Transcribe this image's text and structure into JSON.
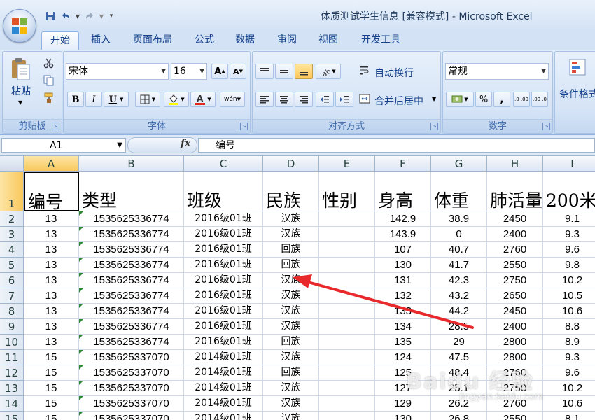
{
  "window": {
    "title": "体质测试学生信息  [兼容模式] - Microsoft Excel"
  },
  "ribbon": {
    "tabs": [
      "开始",
      "插入",
      "页面布局",
      "公式",
      "数据",
      "审阅",
      "视图",
      "开发工具"
    ],
    "active_tab": "开始",
    "clipboard": {
      "paste_label": "粘贴",
      "group_label": "剪贴板"
    },
    "font": {
      "name": "宋体",
      "size": "16",
      "group_label": "字体",
      "bold": "B",
      "italic": "I",
      "underline": "U",
      "grow": "A",
      "shrink": "A",
      "phonetic": "wén"
    },
    "alignment": {
      "wrap_label": "自动换行",
      "merge_label": "合并后居中",
      "group_label": "对齐方式"
    },
    "number": {
      "format": "常规",
      "group_label": "数字",
      "percent": "%",
      "comma": ",",
      "inc_decimal": ".0 .00",
      "dec_decimal": ".00 .0"
    },
    "styles": {
      "cond_format_label": "条件格式"
    }
  },
  "formula_bar": {
    "name_box": "A1",
    "fx_label": "fx",
    "content": "编号"
  },
  "sheet": {
    "columns": [
      "A",
      "B",
      "C",
      "D",
      "E",
      "F",
      "G",
      "H",
      "I"
    ],
    "row_numbers": [
      "1",
      "2",
      "3",
      "4",
      "5",
      "6",
      "7",
      "8",
      "9",
      "10",
      "11",
      "12",
      "13",
      "14",
      "15"
    ],
    "headers": [
      "编号",
      "类型",
      "班级",
      "民族",
      "性别",
      "身高",
      "体重",
      "肺活量",
      "200米"
    ],
    "rows": [
      [
        "13",
        "1535625336774",
        "2016级01班",
        "汉族",
        "",
        "142.9",
        "38.9",
        "2450",
        "9.1"
      ],
      [
        "13",
        "1535625336774",
        "2016级01班",
        "汉族",
        "",
        "143.9",
        "0",
        "2400",
        "9.3"
      ],
      [
        "13",
        "1535625336774",
        "2016级01班",
        "回族",
        "",
        "107",
        "40.7",
        "2760",
        "9.6"
      ],
      [
        "13",
        "1535625336774",
        "2016级01班",
        "回族",
        "",
        "130",
        "41.7",
        "2550",
        "9.8"
      ],
      [
        "13",
        "1535625336774",
        "2016级01班",
        "汉族",
        "",
        "131",
        "42.3",
        "2750",
        "10.2"
      ],
      [
        "13",
        "1535625336774",
        "2016级01班",
        "汉族",
        "",
        "132",
        "43.2",
        "2650",
        "10.5"
      ],
      [
        "13",
        "1535625336774",
        "2016级01班",
        "汉族",
        "",
        "133",
        "44.2",
        "2450",
        "10.6"
      ],
      [
        "13",
        "1535625336774",
        "2016级01班",
        "汉族",
        "",
        "134",
        "28.5",
        "2400",
        "8.8"
      ],
      [
        "13",
        "1535625336774",
        "2016级01班",
        "回族",
        "",
        "135",
        "29",
        "2800",
        "8.9"
      ],
      [
        "15",
        "1535625337070",
        "2014级01班",
        "汉族",
        "",
        "124",
        "47.5",
        "2800",
        "9.3"
      ],
      [
        "15",
        "1535625337070",
        "2014级01班",
        "回族",
        "",
        "125",
        "48.4",
        "2760",
        "9.6"
      ],
      [
        "15",
        "1535625337070",
        "2014级01班",
        "汉族",
        "",
        "127",
        "25.1",
        "2750",
        "10.2"
      ],
      [
        "15",
        "1535625337070",
        "2014级01班",
        "汉族",
        "",
        "129",
        "26.2",
        "2760",
        "10.6"
      ],
      [
        "15",
        "1535625337070",
        "2014级01班",
        "汉族",
        "",
        "130",
        "26.8",
        "2550",
        "8.1"
      ]
    ]
  },
  "watermark": {
    "line1": "Baidu 经验",
    "line2": "jingyan.baidu.com"
  },
  "colors": {
    "ribbon_bg": "#cbdcf2",
    "tab_text": "#15428b",
    "arrow": "#e8292b",
    "selection": "#f9c85b"
  }
}
